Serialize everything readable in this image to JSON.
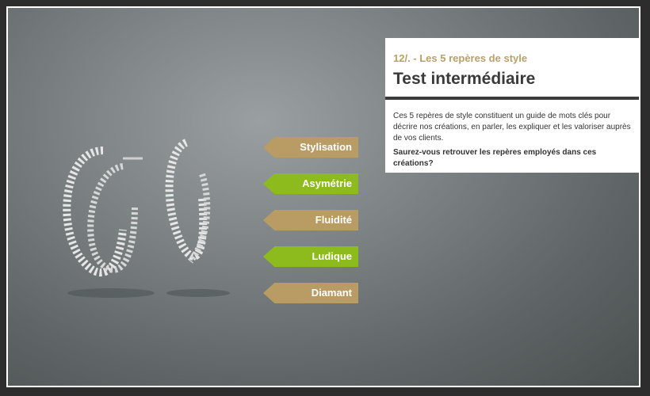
{
  "header": {
    "subtitle": "12/. - Les 5 repères de style",
    "title": "Test intermédiaire"
  },
  "content": {
    "description": "Ces 5 repères de style constituent un guide de mots clés pour décrire nos créations, en parler, les expliquer et les valoriser auprès de vos clients.",
    "question": "Saurez-vous retrouver les repères employés dans ces créations?"
  },
  "tags": [
    {
      "label": "Stylisation",
      "color": "#b99c63"
    },
    {
      "label": "Asymétrie",
      "color": "#8dba1d"
    },
    {
      "label": "Fluidité",
      "color": "#b99c63"
    },
    {
      "label": "Ludique",
      "color": "#8dba1d"
    },
    {
      "label": "Diamant",
      "color": "#b99c63"
    }
  ],
  "image": {
    "icon": "earrings-image"
  }
}
